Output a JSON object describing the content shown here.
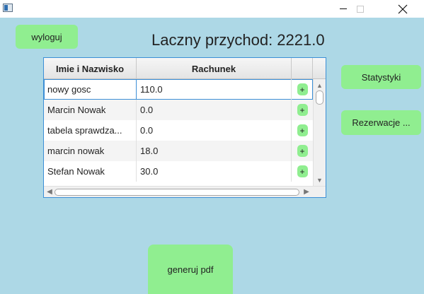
{
  "window": {
    "icon": "app-window-icon",
    "minimize_glyph": "—",
    "close_glyph": "✕"
  },
  "toolbar": {
    "logout_label": "wyloguj",
    "revenue_title": "Laczny przychod: 2221.0",
    "stats_label": "Statystyki",
    "reservations_label": "Rezerwacje ...",
    "pdf_label": "generuj pdf"
  },
  "table": {
    "columns": [
      "Imie i Nazwisko",
      "Rachunek",
      ""
    ],
    "rows": [
      {
        "name": "nowy gosc",
        "bill": "110.0",
        "action": "+"
      },
      {
        "name": "Marcin Nowak",
        "bill": "0.0",
        "action": "+"
      },
      {
        "name": "tabela sprawdza...",
        "bill": "0.0",
        "action": "+"
      },
      {
        "name": "marcin nowak",
        "bill": "18.0",
        "action": "+"
      },
      {
        "name": "Stefan Nowak",
        "bill": "30.0",
        "action": "+"
      }
    ]
  },
  "colors": {
    "background": "#add8e6",
    "button": "#90ee90",
    "table_focus": "#3c8fd6"
  }
}
